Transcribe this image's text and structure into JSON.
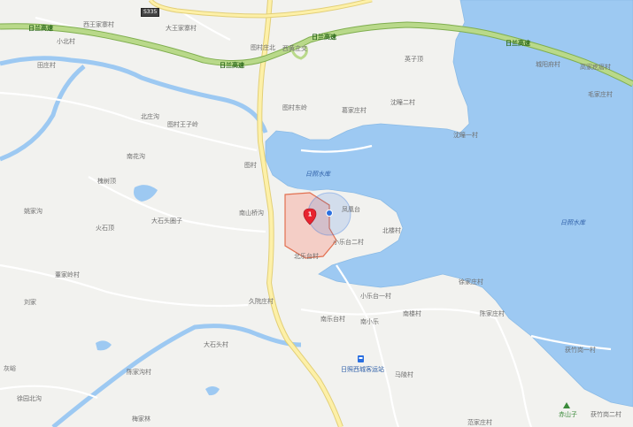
{
  "road_shield": "S335",
  "highways": [
    {
      "label": "日兰高速"
    },
    {
      "label": "日兰高速"
    },
    {
      "label": "日兰高速"
    },
    {
      "label": "日兰高速"
    }
  ],
  "waters": [
    {
      "label": "日照水库"
    },
    {
      "label": "日照水库"
    }
  ],
  "places": [
    "西王家寨村",
    "大王家寨村",
    "小北村",
    "田庄村",
    "图村庄北",
    "西黄立交",
    "英子顶",
    "城阳府村",
    "高家疙瘩村",
    "毛家庄村",
    "北庄沟",
    "图村王子岭",
    "图村东岭",
    "葛家庄村",
    "沈疃二村",
    "沈疃一村",
    "南花沟",
    "图村",
    "槐树顶",
    "南山桥沟",
    "凤凰台",
    "姚家沟",
    "大石头圈子",
    "火石顶",
    "小乐台二村",
    "北楼村",
    "北乐台村",
    "董家岭村",
    "刘家",
    "久院庄村",
    "小乐台一村",
    "徐家庄村",
    "南乐台村",
    "南小乐",
    "南楼村",
    "陈家庄村",
    "大石头村",
    "马陵村",
    "陈家沟村",
    "灰峪",
    "徐园北沟",
    "梅家林",
    "范家庄村",
    "获竹岗一村",
    "获竹岗二村"
  ],
  "station": "日照西城客运站",
  "hill": "赤山子",
  "marker_label": "1",
  "colors": {
    "land": "#f2f2ef",
    "water": "#9dc9f2",
    "highway": "#b9d98a",
    "highway_edge": "#7fae4e",
    "main_road": "#fdf0a8",
    "region_fill": "#f4c2b8",
    "region_edge": "#e27050",
    "marker": "#e8232f",
    "location_dot": "#2a6fe0"
  }
}
